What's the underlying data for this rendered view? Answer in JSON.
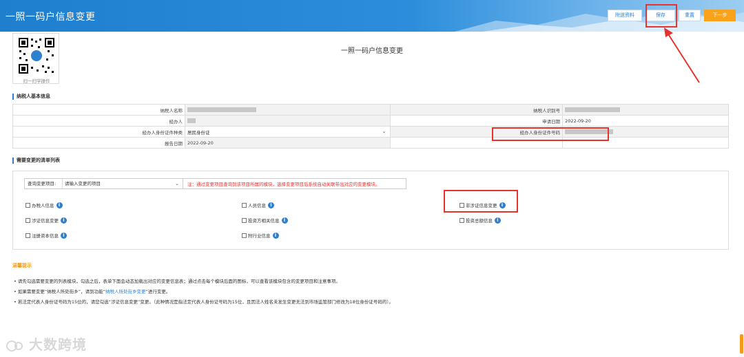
{
  "header": {
    "title": "一照一码户信息变更",
    "buttons": {
      "attach": "附送资料",
      "save": "保存",
      "reset": "重置",
      "next": "下一步"
    }
  },
  "qr": {
    "caption": "扫一扫学操作"
  },
  "page_title": "一照一码户信息变更",
  "basic": {
    "section_title": "纳税人基本信息",
    "rows": [
      {
        "l1": "纳税人名称",
        "v1": "",
        "l2": "纳税人识别号",
        "v2": ""
      },
      {
        "l1": "经办人",
        "v1": "",
        "l2": "申请日期",
        "v2": "2022-09-20"
      },
      {
        "l1": "经办人身份证件种类",
        "v1": "居民身份证",
        "l2": "经办人身份证件号码",
        "v2": ""
      },
      {
        "l1": "报告日期",
        "v1": "2022-09-20",
        "l2": "",
        "v2": ""
      }
    ]
  },
  "change_list": {
    "section_title": "需要变更的清单列表",
    "query_label": "查询变更项目:",
    "query_placeholder": "请输入变更的项目",
    "query_note": "注：通过变更项目查询到该项目所属的模块，选择变更项目后系统自动关联带出对应的变更模块。",
    "items": [
      "办税人信息",
      "人员信息",
      "非涉证信息变更",
      "涉证信息变更",
      "投资方相关信息",
      "投资总额信息",
      "注册资本信息",
      "附行业信息"
    ]
  },
  "tips": {
    "title": "温馨提示",
    "t1": "• 请先勾选需要变更的列表模块，勾选之后，表单下面会动态加载出对应的变更信息表；通过点击每个模块后面的图标，可以查看该模块包含的变更项目和注意事项。",
    "t2a": "• 如果需要变更“纳税人所处街乡”，请到功能“",
    "t2link": "纳税人所处街乡变更",
    "t2b": "”进行变更。",
    "t3": "• 若法定代表人身份证号码为15位的，请您勾选“涉证信息变更”变更。（此种情况是指法定代表人身份证号码为15位，且因法人姓名未发生变更无法到市场监管部门修改为18位身份证号码的）。"
  },
  "watermark": "大数跨境",
  "colors": {
    "header": "#2b8ddb",
    "accent": "#2d7fd0",
    "next": "#f9a21a",
    "annotation": "#e8332d"
  }
}
